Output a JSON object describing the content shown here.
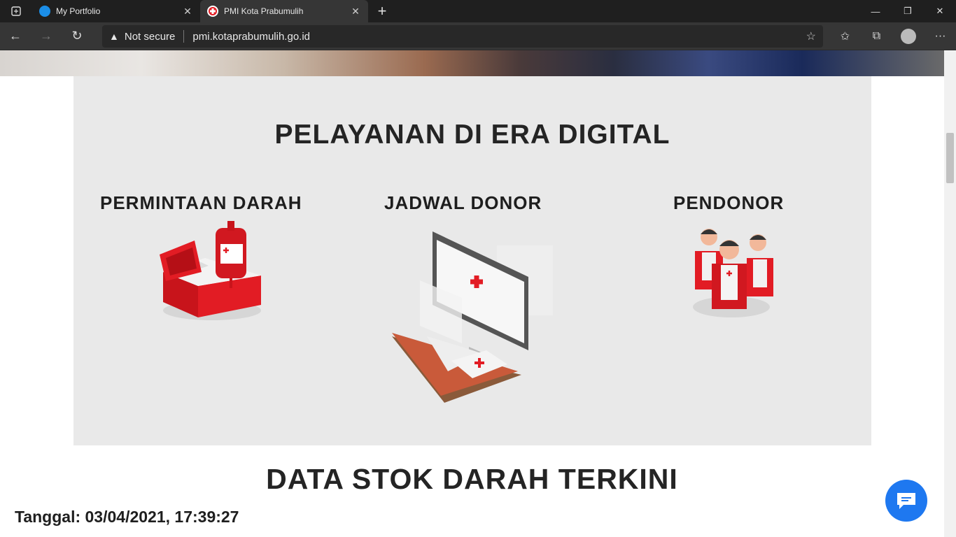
{
  "browser": {
    "tabs": [
      {
        "title": "My Portfolio",
        "active": false
      },
      {
        "title": "PMI Kota Prabumulih",
        "active": true
      }
    ],
    "address": {
      "security_label": "Not secure",
      "url": "pmi.kotaprabumulih.go.id"
    }
  },
  "page": {
    "section_title": "PELAYANAN DI ERA DIGITAL",
    "services": [
      {
        "label": "PERMINTAAN DARAH",
        "icon": "blood-bag-cooler-icon"
      },
      {
        "label": "JADWAL DONOR",
        "icon": "monitor-medical-icon"
      },
      {
        "label": "PENDONOR",
        "icon": "donor-group-icon"
      }
    ],
    "stock_title": "DATA STOK DARAH TERKINI",
    "date_text": "Tanggal: 03/04/2021, 17:39:27"
  },
  "colors": {
    "brand_red": "#e21c24",
    "chat_blue": "#1e78f0",
    "section_bg": "#e9e9e9"
  }
}
